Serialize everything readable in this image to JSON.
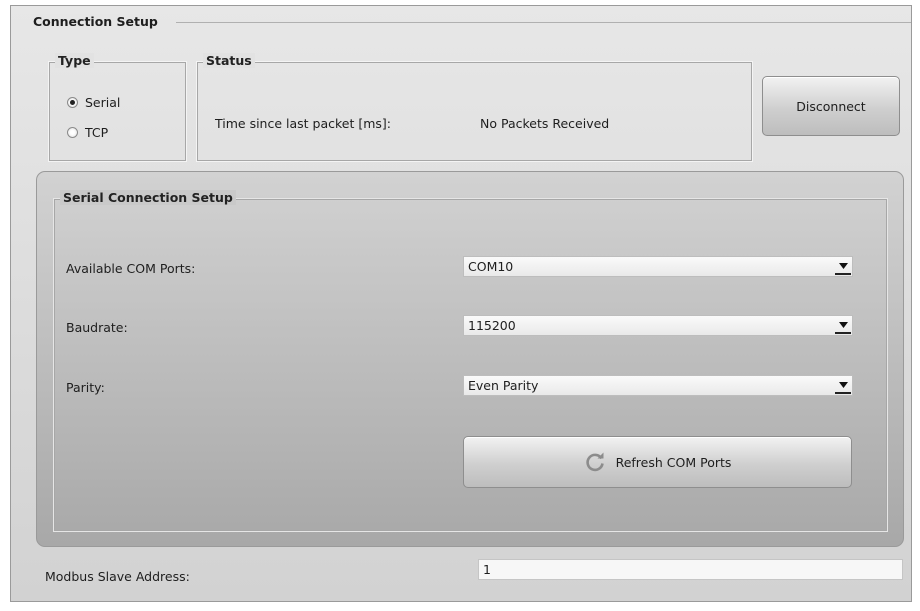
{
  "connection_setup": {
    "title": "Connection Setup",
    "type": {
      "title": "Type",
      "options": [
        {
          "label": "Serial",
          "checked": true
        },
        {
          "label": "TCP",
          "checked": false
        }
      ]
    },
    "status": {
      "title": "Status",
      "time_label": "Time since last packet [ms]:",
      "time_value": "No Packets Received"
    },
    "disconnect_label": "Disconnect",
    "serial_setup": {
      "title": "Serial Connection Setup",
      "com_ports_label": "Available COM Ports:",
      "com_ports_value": "COM10",
      "baudrate_label": "Baudrate:",
      "baudrate_value": "115200",
      "parity_label": "Parity:",
      "parity_value": "Even Parity",
      "refresh_label": "Refresh COM Ports",
      "refresh_icon": "refresh-icon"
    },
    "modbus_label": "Modbus Slave Address:",
    "modbus_value": "1"
  }
}
